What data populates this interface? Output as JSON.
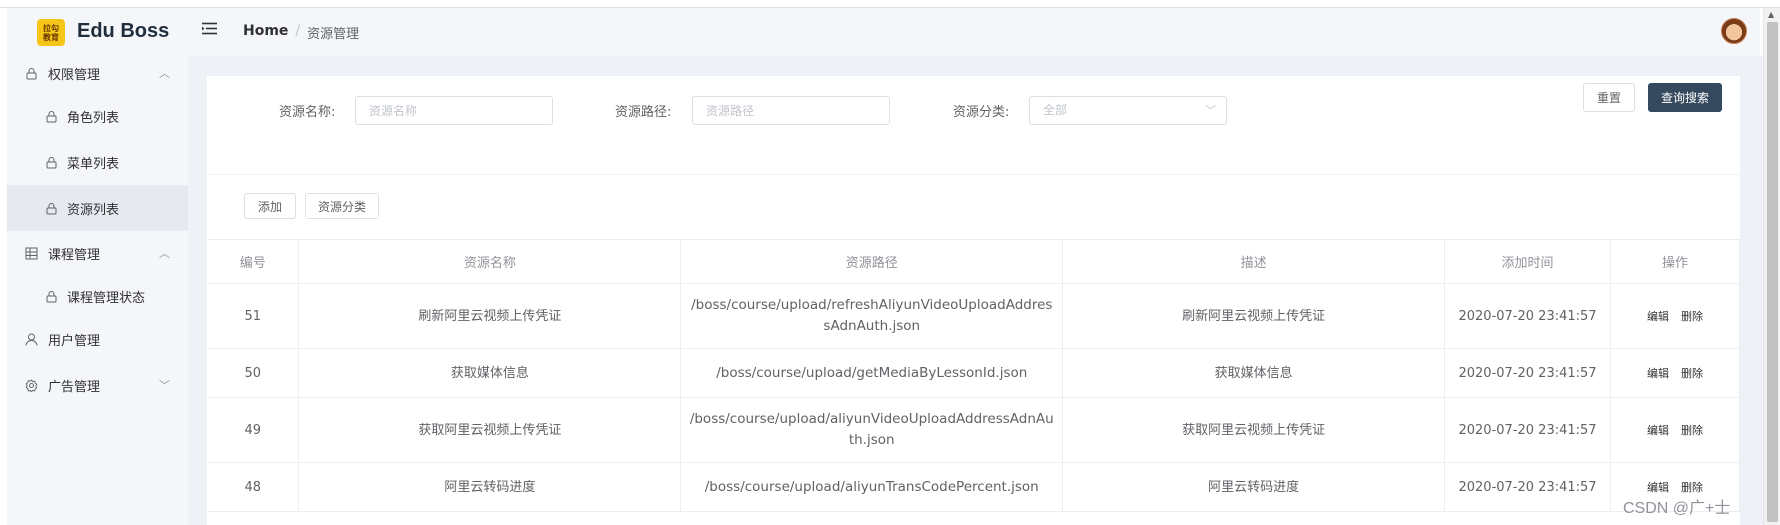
{
  "brand": {
    "logo_line1": "拉勾",
    "logo_line2": "教育",
    "title": "Edu Boss"
  },
  "sidebar": {
    "groups": [
      {
        "label": "权限管理",
        "icon": "lock-icon",
        "expanded": true,
        "children": [
          {
            "label": "角色列表",
            "icon": "lock-icon"
          },
          {
            "label": "菜单列表",
            "icon": "lock-icon"
          },
          {
            "label": "资源列表",
            "icon": "lock-icon",
            "active": true
          }
        ]
      },
      {
        "label": "课程管理",
        "icon": "grid-icon",
        "expanded": true,
        "children": [
          {
            "label": "课程管理状态",
            "icon": "lock-icon"
          }
        ]
      },
      {
        "label": "用户管理",
        "icon": "user-icon"
      },
      {
        "label": "广告管理",
        "icon": "gear-icon",
        "expanded": false
      }
    ]
  },
  "header": {
    "breadcrumb": {
      "home": "Home",
      "separator": "/",
      "current": "资源管理"
    }
  },
  "search": {
    "name_label": "资源名称:",
    "name_placeholder": "资源名称",
    "path_label": "资源路径:",
    "path_placeholder": "资源路径",
    "category_label": "资源分类:",
    "category_value": "全部",
    "reset_label": "重置",
    "search_label": "查询搜索"
  },
  "toolbar": {
    "add_label": "添加",
    "category_label": "资源分类"
  },
  "table": {
    "headers": [
      "编号",
      "资源名称",
      "资源路径",
      "描述",
      "添加时间",
      "操作"
    ],
    "rows": [
      {
        "id": "51",
        "name": "刷新阿里云视频上传凭证",
        "path": "/boss/course/upload/refreshAliyunVideoUploadAddressAdnAuth.json",
        "desc": "刷新阿里云视频上传凭证",
        "time": "2020-07-20 23:41:57",
        "edit": "编辑",
        "del": "删除"
      },
      {
        "id": "50",
        "name": "获取媒体信息",
        "path": "/boss/course/upload/getMediaByLessonId.json",
        "desc": "获取媒体信息",
        "time": "2020-07-20 23:41:57",
        "edit": "编辑",
        "del": "删除"
      },
      {
        "id": "49",
        "name": "获取阿里云视频上传凭证",
        "path": "/boss/course/upload/aliyunVideoUploadAddressAdnAuth.json",
        "desc": "获取阿里云视频上传凭证",
        "time": "2020-07-20 23:41:57",
        "edit": "编辑",
        "del": "删除"
      },
      {
        "id": "48",
        "name": "阿里云转码进度",
        "path": "/boss/course/upload/aliyunTransCodePercent.json",
        "desc": "阿里云转码进度",
        "time": "2020-07-20 23:41:57",
        "edit": "编辑",
        "del": "删除"
      }
    ]
  },
  "watermark": "CSDN @广+士",
  "colors": {
    "primary": "#35495e",
    "sidebar_bg": "#f4f6f9",
    "active_bg": "#e6eaf0",
    "main_bg": "#eef1f6"
  }
}
